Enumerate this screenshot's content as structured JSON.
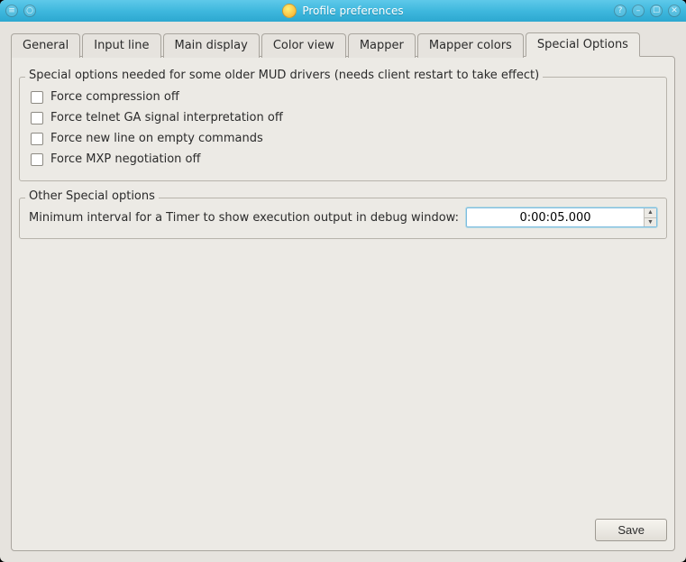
{
  "window": {
    "title": "Profile preferences"
  },
  "tabs": [
    {
      "label": "General"
    },
    {
      "label": "Input line"
    },
    {
      "label": "Main display"
    },
    {
      "label": "Color view"
    },
    {
      "label": "Mapper"
    },
    {
      "label": "Mapper colors"
    },
    {
      "label": "Special Options"
    }
  ],
  "active_tab_index": 6,
  "groups": {
    "compat": {
      "legend": "Special options needed for some older MUD drivers (needs client restart to take effect)",
      "options": [
        {
          "label": "Force compression off",
          "checked": false
        },
        {
          "label": "Force telnet GA signal interpretation off",
          "checked": false
        },
        {
          "label": "Force new line on empty commands",
          "checked": false
        },
        {
          "label": "Force MXP negotiation off",
          "checked": false
        }
      ]
    },
    "other": {
      "legend": "Other Special options",
      "timer_label": "Minimum interval for a Timer to show execution output in debug window:",
      "timer_value": "0:00:05.000"
    }
  },
  "buttons": {
    "save": "Save"
  }
}
